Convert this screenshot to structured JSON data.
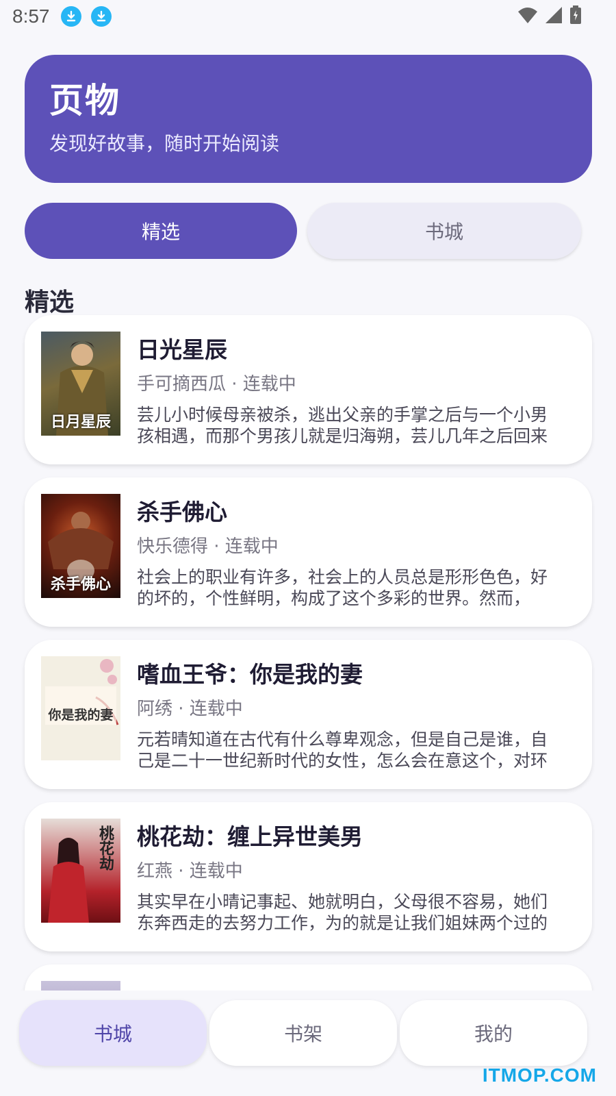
{
  "status_bar": {
    "time": "8:57"
  },
  "hero": {
    "title": "页物",
    "subtitle": "发现好故事，随时开始阅读"
  },
  "tabs": [
    {
      "label": "精选",
      "active": true
    },
    {
      "label": "书城",
      "active": false
    }
  ],
  "section_title": "精选",
  "books": [
    {
      "title": "日光星辰",
      "meta": "手可摘西瓜 · 连载中",
      "desc": "芸儿小时候母亲被杀，逃出父亲的手掌之后与一个小男孩相遇，而那个男孩儿就是归海朔，芸儿几年之后回来",
      "cover_text": "日月星辰"
    },
    {
      "title": "杀手佛心",
      "meta": "快乐德得 · 连载中",
      "desc": "社会上的职业有许多，社会上的人员总是形形色色，好的坏的，个性鲜明，构成了这个多彩的世界。然而，",
      "cover_text": "杀手佛心"
    },
    {
      "title": "嗜血王爷：你是我的妻",
      "meta": "阿绣 · 连载中",
      "desc": "元若晴知道在古代有什么尊卑观念，但是自己是谁，自己是二十一世纪新时代的女性，怎么会在意这个，对环",
      "cover_text": "你是我的妻"
    },
    {
      "title": "桃花劫：缠上异世美男",
      "meta": "红燕 · 连载中",
      "desc": "其实早在小晴记事起、她就明白，父母很不容易，她们东奔西走的去努力工作，为的就是让我们姐妹两个过的",
      "cover_text": "桃花劫"
    },
    {
      "title": "",
      "meta": "",
      "desc": "",
      "cover_text": ""
    }
  ],
  "bottom_nav": [
    {
      "label": "书城",
      "active": true
    },
    {
      "label": "书架",
      "active": false
    },
    {
      "label": "我的",
      "active": false
    }
  ],
  "watermark": "ITMOP.COM",
  "colors": {
    "primary": "#5d51b8",
    "nav_active_bg": "#e6e2fb",
    "download_badge": "#27b6f5"
  },
  "icons": [
    "download-icon",
    "wifi-icon",
    "signal-icon",
    "battery-icon"
  ]
}
